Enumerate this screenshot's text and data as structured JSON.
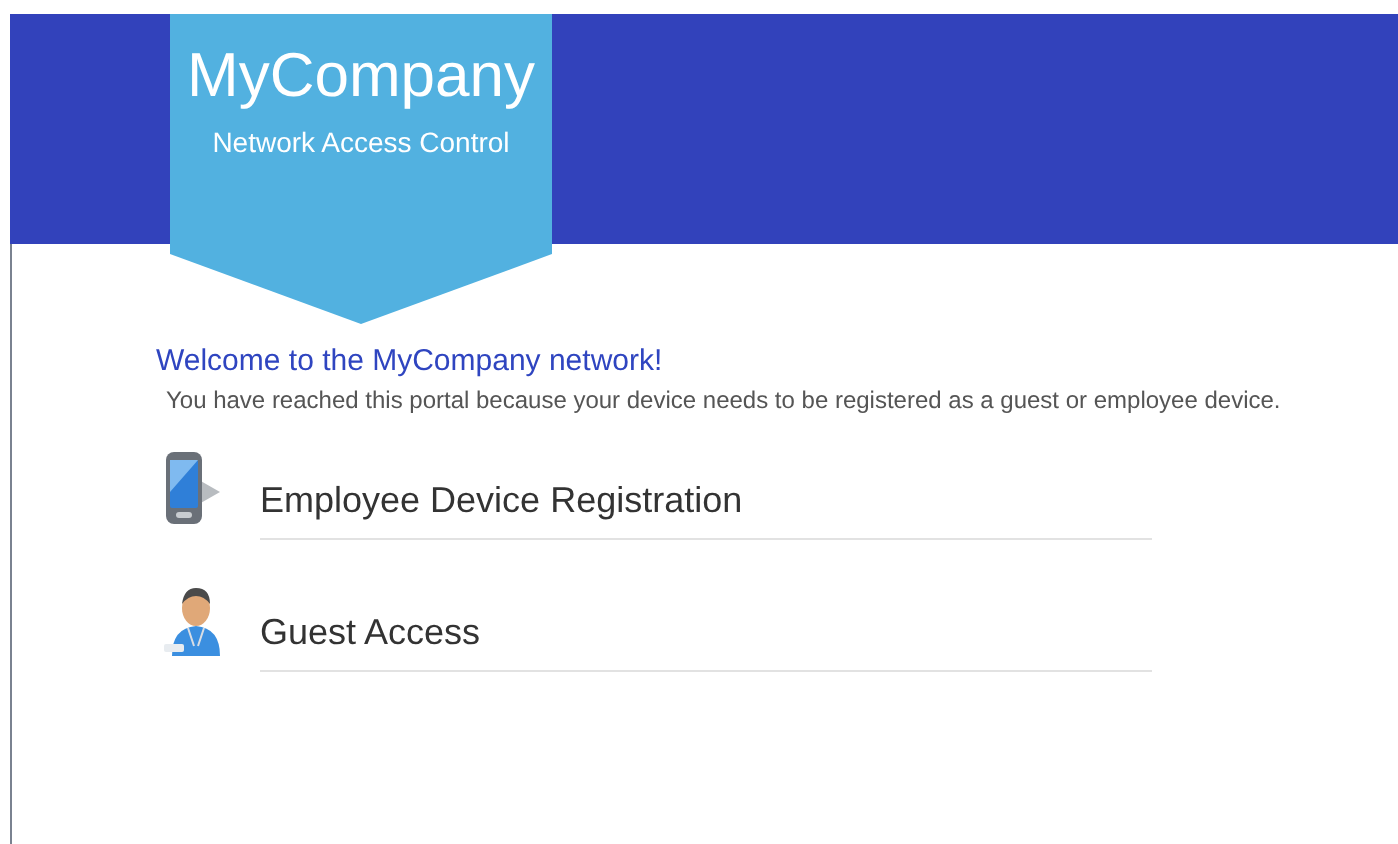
{
  "banner": {
    "title": "MyCompany",
    "subtitle": "Network Access Control"
  },
  "welcome": {
    "heading": "Welcome to the MyCompany network!",
    "message": "You have reached this portal because your device needs to be registered as a guest or employee device."
  },
  "options": [
    {
      "kind": "device",
      "label": "Employee Device Registration"
    },
    {
      "kind": "guest",
      "label": "Guest Access"
    }
  ]
}
